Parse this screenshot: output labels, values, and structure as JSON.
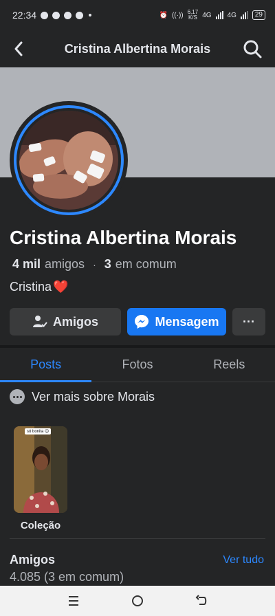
{
  "status_bar": {
    "time": "22:34",
    "speed_value": "6,17",
    "speed_unit": "K/S",
    "net1": "4G",
    "net2": "4G",
    "battery": "29"
  },
  "header": {
    "title": "Cristina Albertina Morais"
  },
  "profile": {
    "name": "Cristina Albertina Morais",
    "friends_count": "4 mil",
    "friends_label": "amigos",
    "mutual_count": "3",
    "mutual_label": "em comum",
    "bio": "Cristina",
    "bio_emoji": "❤️"
  },
  "actions": {
    "friends_button": "Amigos",
    "message_button": "Mensagem",
    "more_button": "···"
  },
  "tabs": [
    {
      "label": "Posts",
      "active": true
    },
    {
      "label": "Fotos",
      "active": false
    },
    {
      "label": "Reels",
      "active": false
    }
  ],
  "more_about": "Ver mais sobre Morais",
  "collection": {
    "caption": "só bonita 😊",
    "label": "Coleção"
  },
  "friends_section": {
    "title": "Amigos",
    "see_all": "Ver tudo",
    "count_text": "4.085 (3 em comum)"
  },
  "colors": {
    "background": "#242526",
    "accent": "#2d88ff",
    "message_button": "#1877f2",
    "cover": "#b0b3b8"
  },
  "icons": [
    "back-arrow-icon",
    "search-icon",
    "friends-check-icon",
    "messenger-icon",
    "more-dots-icon",
    "info-dots-icon",
    "recents-icon",
    "home-icon",
    "back-icon"
  ]
}
